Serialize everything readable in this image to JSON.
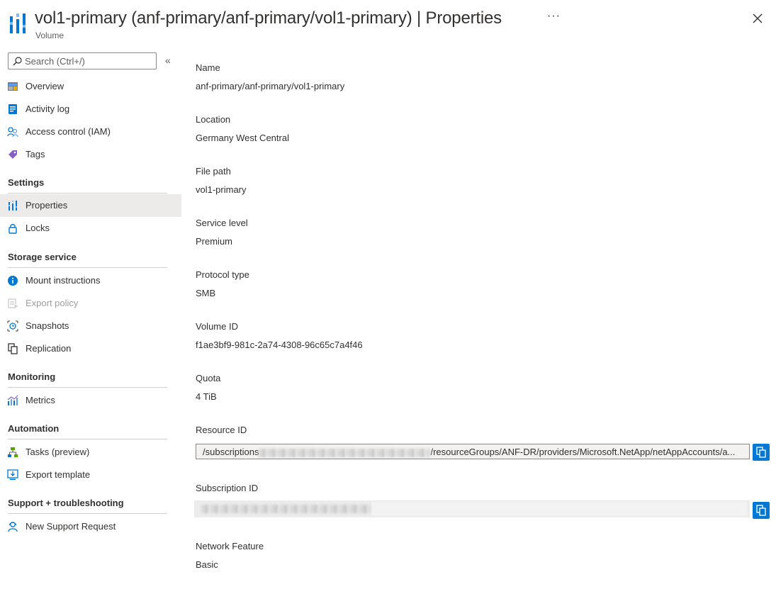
{
  "header": {
    "title_main": "vol1-primary (anf-primary/anf-primary/vol1-primary)",
    "title_separator": "|",
    "title_section": "Properties",
    "subtitle": "Volume",
    "more_label": "···"
  },
  "search": {
    "placeholder": "Search (Ctrl+/)",
    "collapse_glyph": "«"
  },
  "nav": {
    "overview": "Overview",
    "activity_log": "Activity log",
    "access_control": "Access control (IAM)",
    "tags": "Tags",
    "settings_header": "Settings",
    "properties": "Properties",
    "locks": "Locks",
    "storage_header": "Storage service",
    "mount_instructions": "Mount instructions",
    "export_policy": "Export policy",
    "snapshots": "Snapshots",
    "replication": "Replication",
    "monitoring_header": "Monitoring",
    "metrics": "Metrics",
    "automation_header": "Automation",
    "tasks_preview": "Tasks (preview)",
    "export_template": "Export template",
    "support_header": "Support + troubleshooting",
    "new_support_request": "New Support Request"
  },
  "properties": {
    "name_label": "Name",
    "name_value": "anf-primary/anf-primary/vol1-primary",
    "location_label": "Location",
    "location_value": "Germany West Central",
    "file_path_label": "File path",
    "file_path_value": "vol1-primary",
    "service_level_label": "Service level",
    "service_level_value": "Premium",
    "protocol_label": "Protocol type",
    "protocol_value": "SMB",
    "volume_id_label": "Volume ID",
    "volume_id_value": "f1ae3bf9-981c-2a74-4308-96c65c7a4f46",
    "quota_label": "Quota",
    "quota_value": "4 TiB",
    "resource_id_label": "Resource ID",
    "resource_id_prefix": "/subscriptions",
    "resource_id_suffix": "/resourceGroups/ANF-DR/providers/Microsoft.NetApp/netAppAccounts/a...",
    "subscription_id_label": "Subscription ID",
    "network_feature_label": "Network Feature",
    "network_feature_value": "Basic"
  },
  "colors": {
    "accent": "#0078d4",
    "selected_bg": "#edebe9"
  }
}
